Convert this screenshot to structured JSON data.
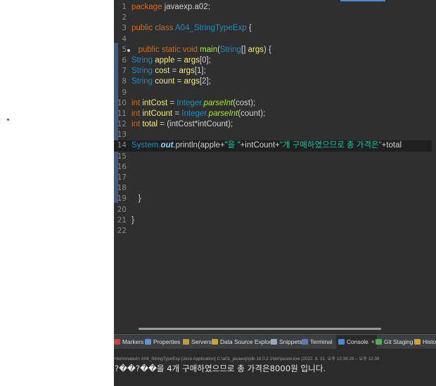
{
  "editor": {
    "lines": [
      {
        "n": "1",
        "parts": [
          {
            "t": "package ",
            "c": "kw"
          },
          {
            "t": "javaexp.a02;",
            "c": ""
          }
        ]
      },
      {
        "n": "2",
        "parts": []
      },
      {
        "n": "3",
        "parts": [
          {
            "t": "public ",
            "c": "kw"
          },
          {
            "t": "class ",
            "c": "kw"
          },
          {
            "t": "A04_StringTypeExp",
            "c": "ty"
          },
          {
            "t": " {",
            "c": ""
          }
        ]
      },
      {
        "n": "4",
        "parts": []
      },
      {
        "n": "5",
        "marker": true,
        "parts": [
          {
            "t": "   public ",
            "c": "kw"
          },
          {
            "t": "static ",
            "c": "kw"
          },
          {
            "t": "void ",
            "c": "kw"
          },
          {
            "t": "main",
            "c": "mth"
          },
          {
            "t": "(",
            "c": ""
          },
          {
            "t": "String",
            "c": "ty"
          },
          {
            "t": "[] ",
            "c": ""
          },
          {
            "t": "args",
            "c": "var"
          },
          {
            "t": ") {",
            "c": ""
          }
        ]
      },
      {
        "n": "6",
        "parts": [
          {
            "t": "String ",
            "c": "ty"
          },
          {
            "t": "apple",
            "c": "var"
          },
          {
            "t": " = ",
            "c": ""
          },
          {
            "t": "args",
            "c": "var"
          },
          {
            "t": "[0];",
            "c": ""
          }
        ]
      },
      {
        "n": "7",
        "parts": [
          {
            "t": "String ",
            "c": "ty"
          },
          {
            "t": "cost",
            "c": "var"
          },
          {
            "t": " = ",
            "c": ""
          },
          {
            "t": "args",
            "c": "var"
          },
          {
            "t": "[1];",
            "c": ""
          }
        ]
      },
      {
        "n": "8",
        "parts": [
          {
            "t": "String ",
            "c": "ty"
          },
          {
            "t": "count",
            "c": "var"
          },
          {
            "t": " = ",
            "c": ""
          },
          {
            "t": "args",
            "c": "var"
          },
          {
            "t": "[2];",
            "c": ""
          }
        ]
      },
      {
        "n": "9",
        "parts": []
      },
      {
        "n": "10",
        "parts": [
          {
            "t": "int ",
            "c": "kw"
          },
          {
            "t": "intCost",
            "c": "var"
          },
          {
            "t": " = ",
            "c": ""
          },
          {
            "t": "Integer.",
            "c": "ty"
          },
          {
            "t": "parseInt",
            "c": "mth it"
          },
          {
            "t": "(cost);",
            "c": ""
          }
        ]
      },
      {
        "n": "11",
        "parts": [
          {
            "t": "int ",
            "c": "kw"
          },
          {
            "t": "intCount",
            "c": "var"
          },
          {
            "t": " = ",
            "c": ""
          },
          {
            "t": "Integer.",
            "c": "ty"
          },
          {
            "t": "parseInt",
            "c": "mth it"
          },
          {
            "t": "(count);",
            "c": ""
          }
        ]
      },
      {
        "n": "12",
        "parts": [
          {
            "t": "int ",
            "c": "kw"
          },
          {
            "t": "total",
            "c": "var"
          },
          {
            "t": " = (intCost*intCount);",
            "c": ""
          }
        ]
      },
      {
        "n": "13",
        "parts": []
      },
      {
        "n": "14",
        "current": true,
        "parts": [
          {
            "t": "System.",
            "c": "ty"
          },
          {
            "t": "out",
            "c": "fld"
          },
          {
            "t": ".println(apple+",
            "c": ""
          },
          {
            "t": "\"을 \"",
            "c": "str"
          },
          {
            "t": "+intCount+",
            "c": ""
          },
          {
            "t": "\"개 구매하였으므로 총 가격은\"",
            "c": "str"
          },
          {
            "t": "+total",
            "c": ""
          }
        ]
      },
      {
        "n": "15",
        "parts": []
      },
      {
        "n": "16",
        "parts": []
      },
      {
        "n": "17",
        "parts": []
      },
      {
        "n": "18",
        "parts": []
      },
      {
        "n": "19",
        "parts": [
          {
            "t": "   }",
            "c": ""
          }
        ]
      },
      {
        "n": "20",
        "parts": []
      },
      {
        "n": "21",
        "parts": [
          {
            "t": "}",
            "c": ""
          }
        ]
      },
      {
        "n": "22",
        "parts": []
      }
    ]
  },
  "bottom_tabs": [
    {
      "name": "tab-markers",
      "label": "Markers",
      "icon": "markers-icon",
      "color": "#c04848"
    },
    {
      "name": "tab-properties",
      "label": "Properties",
      "icon": "properties-icon",
      "color": "#6a8fc8"
    },
    {
      "name": "tab-servers",
      "label": "Servers",
      "icon": "servers-icon",
      "color": "#b8a040"
    },
    {
      "name": "tab-data-source-explorer",
      "label": "Data Source Explorer",
      "icon": "database-icon",
      "color": "#d0a038"
    },
    {
      "name": "tab-snippets",
      "label": "Snippets",
      "icon": "snippets-icon",
      "color": "#9aa8b8"
    },
    {
      "name": "tab-terminal",
      "label": "Terminal",
      "icon": "terminal-icon",
      "color": "#5a7ab8"
    },
    {
      "name": "tab-console",
      "label": "Console",
      "icon": "console-icon",
      "color": "#4a8ad0",
      "active": true,
      "close": "×"
    },
    {
      "name": "tab-git-staging",
      "label": "Git Staging",
      "icon": "git-staging-icon",
      "color": "#58a858"
    },
    {
      "name": "tab-history",
      "label": "Histo",
      "icon": "history-icon",
      "color": "#d0a038"
    }
  ],
  "console": {
    "terminated": "<terminated> A04_StringTypeExp [Java Application] C:\\a01_javaexp\\jdk-18.0.2.1\\bin\\javaw.exe  (2022. 8. 31. 오후 12:38:28 – 오후 12:38",
    "output": "?��?��을 4개 구매하였으므로 총 가격은8000원 입니다."
  },
  "colors": {
    "keyword": "#cc6c1d",
    "type": "#1290c3",
    "variable": "#f3ec79",
    "method": "#a7ec21",
    "string": "#17c6a3",
    "field": "#8dd8ff"
  }
}
